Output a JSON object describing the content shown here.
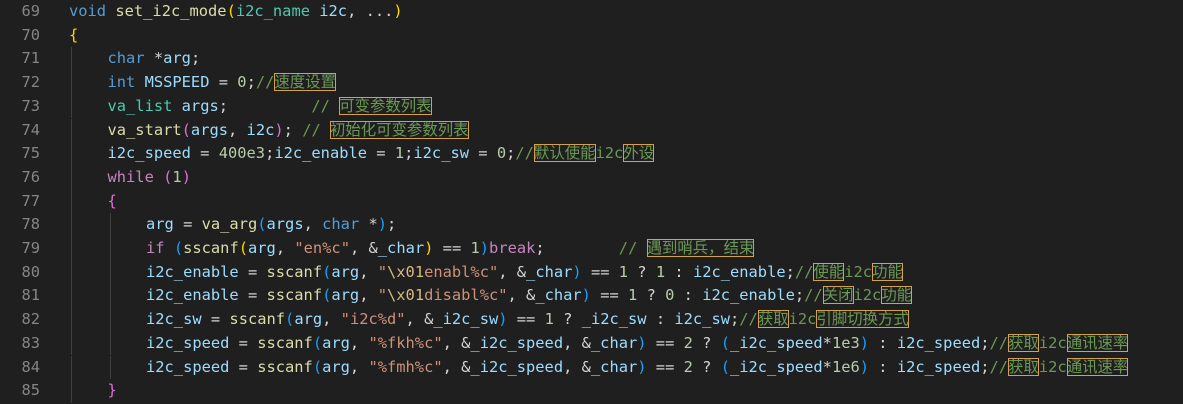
{
  "editor": {
    "lines": [
      {
        "num": "69",
        "indent": 0,
        "tokens": [
          [
            "kw",
            "void"
          ],
          [
            "pl",
            " "
          ],
          [
            "fn",
            "set_i2c_mode"
          ],
          [
            "b1",
            "("
          ],
          [
            "ty",
            "i2c_name"
          ],
          [
            "pl",
            " "
          ],
          [
            "var",
            "i2c"
          ],
          [
            "pl",
            ", ..."
          ],
          [
            "b1",
            ")"
          ]
        ]
      },
      {
        "num": "70",
        "indent": 0,
        "tokens": [
          [
            "b1",
            "{"
          ]
        ]
      },
      {
        "num": "71",
        "indent": 1,
        "tokens": [
          [
            "kw",
            "char"
          ],
          [
            "pl",
            " *"
          ],
          [
            "var",
            "arg"
          ],
          [
            "pl",
            ";"
          ]
        ]
      },
      {
        "num": "72",
        "indent": 1,
        "tokens": [
          [
            "kw",
            "int"
          ],
          [
            "pl",
            " "
          ],
          [
            "var",
            "MSSPEED"
          ],
          [
            "pl",
            " = "
          ],
          [
            "num",
            "0"
          ],
          [
            "pl",
            ";"
          ],
          [
            "cm",
            "//"
          ],
          [
            "cmh",
            "速度设置"
          ]
        ]
      },
      {
        "num": "73",
        "indent": 1,
        "tokens": [
          [
            "ty",
            "va_list"
          ],
          [
            "pl",
            " "
          ],
          [
            "var",
            "args"
          ],
          [
            "pl",
            ";         "
          ],
          [
            "cm",
            "// "
          ],
          [
            "cmh",
            "可变参数列表"
          ]
        ]
      },
      {
        "num": "74",
        "indent": 1,
        "tokens": [
          [
            "fn",
            "va_start"
          ],
          [
            "b2",
            "("
          ],
          [
            "var",
            "args"
          ],
          [
            "pl",
            ", "
          ],
          [
            "var",
            "i2c"
          ],
          [
            "b2",
            ")"
          ],
          [
            "pl",
            "; "
          ],
          [
            "cm",
            "// "
          ],
          [
            "cmh",
            "初始化可变参数列表"
          ]
        ]
      },
      {
        "num": "75",
        "indent": 1,
        "tokens": [
          [
            "var",
            "i2c_speed"
          ],
          [
            "pl",
            " = "
          ],
          [
            "num",
            "400e3"
          ],
          [
            "pl",
            ";"
          ],
          [
            "var",
            "i2c_enable"
          ],
          [
            "pl",
            " = "
          ],
          [
            "num",
            "1"
          ],
          [
            "pl",
            ";"
          ],
          [
            "var",
            "i2c_sw"
          ],
          [
            "pl",
            " = "
          ],
          [
            "num",
            "0"
          ],
          [
            "pl",
            ";"
          ],
          [
            "cm",
            "//"
          ],
          [
            "cmh",
            "默认使能"
          ],
          [
            "cm",
            "i2c"
          ],
          [
            "cmh",
            "外设"
          ]
        ]
      },
      {
        "num": "76",
        "indent": 1,
        "tokens": [
          [
            "ctl",
            "while"
          ],
          [
            "pl",
            " "
          ],
          [
            "b2",
            "("
          ],
          [
            "num",
            "1"
          ],
          [
            "b2",
            ")"
          ]
        ]
      },
      {
        "num": "77",
        "indent": 1,
        "tokens": [
          [
            "b2",
            "{"
          ]
        ]
      },
      {
        "num": "78",
        "indent": 2,
        "tokens": [
          [
            "var",
            "arg"
          ],
          [
            "pl",
            " = "
          ],
          [
            "fn",
            "va_arg"
          ],
          [
            "b3",
            "("
          ],
          [
            "var",
            "args"
          ],
          [
            "pl",
            ", "
          ],
          [
            "kw",
            "char"
          ],
          [
            "pl",
            " *"
          ],
          [
            "b3",
            ")"
          ],
          [
            "pl",
            ";"
          ]
        ]
      },
      {
        "num": "79",
        "indent": 2,
        "tokens": [
          [
            "ctl",
            "if"
          ],
          [
            "pl",
            " "
          ],
          [
            "b3",
            "("
          ],
          [
            "fn",
            "sscanf"
          ],
          [
            "b1",
            "("
          ],
          [
            "var",
            "arg"
          ],
          [
            "pl",
            ", "
          ],
          [
            "str",
            "\"en%c\""
          ],
          [
            "pl",
            ", &"
          ],
          [
            "var",
            "_char"
          ],
          [
            "b1",
            ")"
          ],
          [
            "pl",
            " == "
          ],
          [
            "num",
            "1"
          ],
          [
            "b3",
            ")"
          ],
          [
            "ctl",
            "break"
          ],
          [
            "pl",
            ";        "
          ],
          [
            "cm",
            "// "
          ],
          [
            "cmh",
            "遇到哨兵，结束"
          ]
        ]
      },
      {
        "num": "80",
        "indent": 2,
        "tokens": [
          [
            "var",
            "i2c_enable"
          ],
          [
            "pl",
            " = "
          ],
          [
            "fn",
            "sscanf"
          ],
          [
            "b3",
            "("
          ],
          [
            "var",
            "arg"
          ],
          [
            "pl",
            ", "
          ],
          [
            "str",
            "\""
          ],
          [
            "esc",
            "\\x01"
          ],
          [
            "str",
            "enabl%c\""
          ],
          [
            "pl",
            ", &"
          ],
          [
            "var",
            "_char"
          ],
          [
            "b3",
            ")"
          ],
          [
            "pl",
            " == "
          ],
          [
            "num",
            "1"
          ],
          [
            "pl",
            " ? "
          ],
          [
            "num",
            "1"
          ],
          [
            "pl",
            " : "
          ],
          [
            "var",
            "i2c_enable"
          ],
          [
            "pl",
            ";"
          ],
          [
            "cm",
            "//"
          ],
          [
            "cmh",
            "使能"
          ],
          [
            "cm",
            "i2c"
          ],
          [
            "cmh",
            "功能"
          ]
        ]
      },
      {
        "num": "81",
        "indent": 2,
        "tokens": [
          [
            "var",
            "i2c_enable"
          ],
          [
            "pl",
            " = "
          ],
          [
            "fn",
            "sscanf"
          ],
          [
            "b3",
            "("
          ],
          [
            "var",
            "arg"
          ],
          [
            "pl",
            ", "
          ],
          [
            "str",
            "\""
          ],
          [
            "esc",
            "\\x01"
          ],
          [
            "str",
            "disabl%c\""
          ],
          [
            "pl",
            ", &"
          ],
          [
            "var",
            "_char"
          ],
          [
            "b3",
            ")"
          ],
          [
            "pl",
            " == "
          ],
          [
            "num",
            "1"
          ],
          [
            "pl",
            " ? "
          ],
          [
            "num",
            "0"
          ],
          [
            "pl",
            " : "
          ],
          [
            "var",
            "i2c_enable"
          ],
          [
            "pl",
            ";"
          ],
          [
            "cm",
            "//"
          ],
          [
            "cmh",
            "关闭"
          ],
          [
            "cm",
            "i2c"
          ],
          [
            "cmh",
            "功能"
          ]
        ]
      },
      {
        "num": "82",
        "indent": 2,
        "tokens": [
          [
            "var",
            "i2c_sw"
          ],
          [
            "pl",
            " = "
          ],
          [
            "fn",
            "sscanf"
          ],
          [
            "b3",
            "("
          ],
          [
            "var",
            "arg"
          ],
          [
            "pl",
            ", "
          ],
          [
            "str",
            "\"i2c%d\""
          ],
          [
            "pl",
            ", &"
          ],
          [
            "var",
            "_i2c_sw"
          ],
          [
            "b3",
            ")"
          ],
          [
            "pl",
            " == "
          ],
          [
            "num",
            "1"
          ],
          [
            "pl",
            " ? "
          ],
          [
            "var",
            "_i2c_sw"
          ],
          [
            "pl",
            " : "
          ],
          [
            "var",
            "i2c_sw"
          ],
          [
            "pl",
            ";"
          ],
          [
            "cm",
            "//"
          ],
          [
            "cmh",
            "获取"
          ],
          [
            "cm",
            "i2c"
          ],
          [
            "cmh",
            "引脚切换方式"
          ]
        ]
      },
      {
        "num": "83",
        "indent": 2,
        "tokens": [
          [
            "var",
            "i2c_speed"
          ],
          [
            "pl",
            " = "
          ],
          [
            "fn",
            "sscanf"
          ],
          [
            "b3",
            "("
          ],
          [
            "var",
            "arg"
          ],
          [
            "pl",
            ", "
          ],
          [
            "str",
            "\"%fkh%c\""
          ],
          [
            "pl",
            ", &"
          ],
          [
            "var",
            "_i2c_speed"
          ],
          [
            "pl",
            ", &"
          ],
          [
            "var",
            "_char"
          ],
          [
            "b3",
            ")"
          ],
          [
            "pl",
            " == "
          ],
          [
            "num",
            "2"
          ],
          [
            "pl",
            " ? "
          ],
          [
            "b3",
            "("
          ],
          [
            "var",
            "_i2c_speed"
          ],
          [
            "pl",
            "*"
          ],
          [
            "num",
            "1e3"
          ],
          [
            "b3",
            ")"
          ],
          [
            "pl",
            " : "
          ],
          [
            "var",
            "i2c_speed"
          ],
          [
            "pl",
            ";"
          ],
          [
            "cm",
            "//"
          ],
          [
            "cmh",
            "获取"
          ],
          [
            "cm",
            "i2c"
          ],
          [
            "cmh",
            "通讯速率"
          ]
        ]
      },
      {
        "num": "84",
        "indent": 2,
        "tokens": [
          [
            "var",
            "i2c_speed"
          ],
          [
            "pl",
            " = "
          ],
          [
            "fn",
            "sscanf"
          ],
          [
            "b3",
            "("
          ],
          [
            "var",
            "arg"
          ],
          [
            "pl",
            ", "
          ],
          [
            "str",
            "\"%fmh%c\""
          ],
          [
            "pl",
            ", &"
          ],
          [
            "var",
            "_i2c_speed"
          ],
          [
            "pl",
            ", &"
          ],
          [
            "var",
            "_char"
          ],
          [
            "b3",
            ")"
          ],
          [
            "pl",
            " == "
          ],
          [
            "num",
            "2"
          ],
          [
            "pl",
            " ? "
          ],
          [
            "b3",
            "("
          ],
          [
            "var",
            "_i2c_speed"
          ],
          [
            "pl",
            "*"
          ],
          [
            "num",
            "1e6"
          ],
          [
            "b3",
            ")"
          ],
          [
            "pl",
            " : "
          ],
          [
            "var",
            "i2c_speed"
          ],
          [
            "pl",
            ";"
          ],
          [
            "cm",
            "//"
          ],
          [
            "cmh",
            "获取"
          ],
          [
            "cm",
            "i2c"
          ],
          [
            "cmh",
            "通讯速率"
          ]
        ]
      },
      {
        "num": "85",
        "indent": 1,
        "tokens": [
          [
            "b2",
            "}"
          ]
        ]
      }
    ]
  }
}
